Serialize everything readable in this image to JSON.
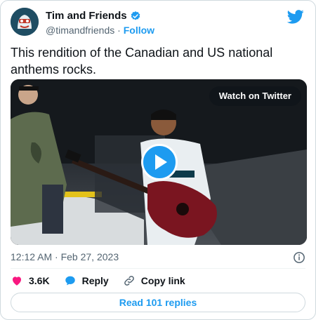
{
  "user": {
    "display_name": "Tim and Friends",
    "handle": "@timandfriends",
    "separator": "·",
    "follow_label": "Follow"
  },
  "tweet": {
    "text": "This rendition of the Canadian and US national anthems rocks.",
    "timestamp": "12:12 AM · Feb 27, 2023"
  },
  "media": {
    "watch_label": "Watch on Twitter",
    "play_icon": "play-icon"
  },
  "actions": {
    "likes_count": "3.6K",
    "reply_label": "Reply",
    "copy_link_label": "Copy link"
  },
  "read_replies_label": "Read 101 replies",
  "colors": {
    "accent": "#1d9bf0",
    "like": "#f91880",
    "verified": "#1d9bf0",
    "muted": "#536471"
  },
  "icons": [
    "twitter-bird-icon",
    "verified-badge-icon",
    "info-icon",
    "heart-icon",
    "reply-bubble-icon",
    "link-icon"
  ]
}
